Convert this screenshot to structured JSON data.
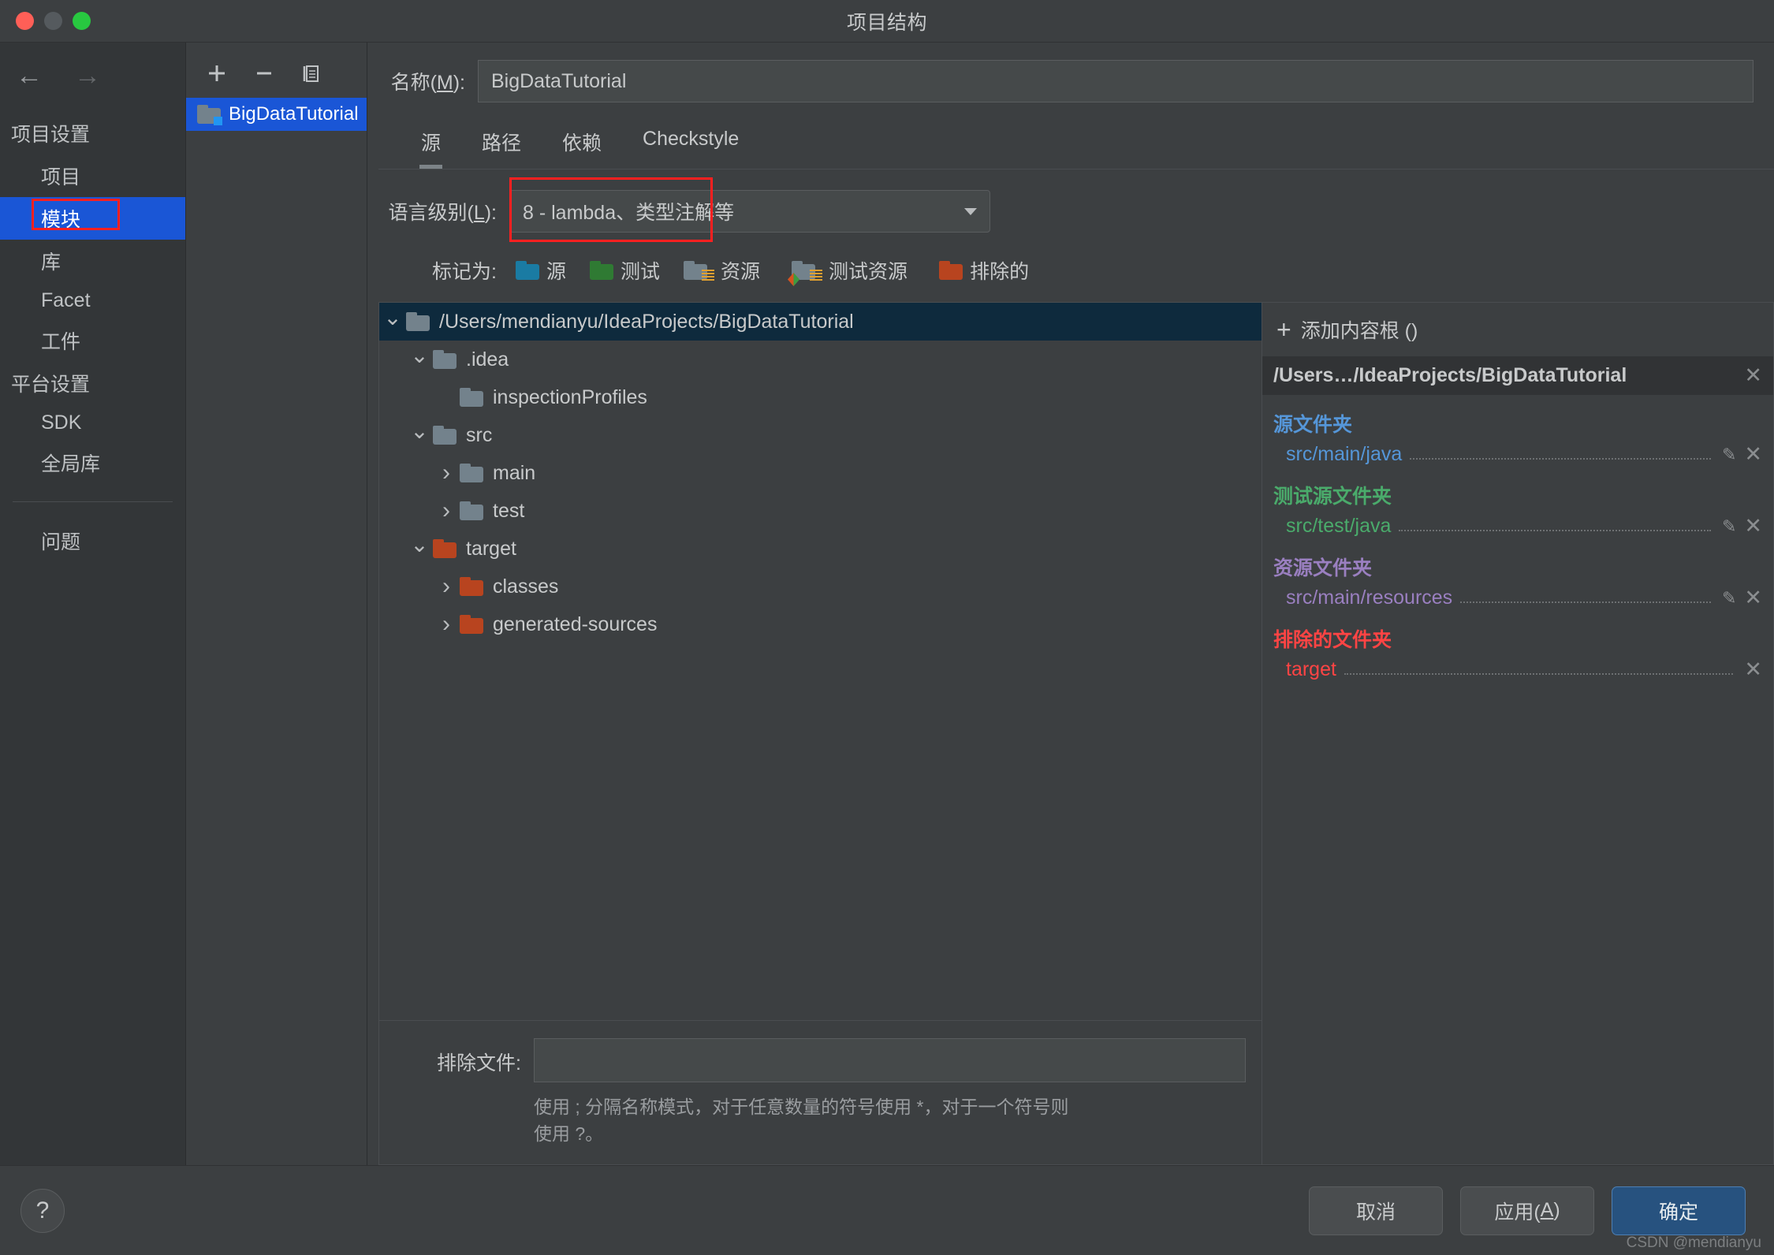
{
  "window": {
    "title": "项目结构"
  },
  "sidebar": {
    "back_icon": "arrow-left-icon",
    "forward_icon": "arrow-right-icon",
    "groups": [
      {
        "label": "项目设置",
        "items": [
          {
            "label": "项目",
            "selected": false
          },
          {
            "label": "模块",
            "selected": true
          },
          {
            "label": "库",
            "selected": false
          },
          {
            "label": "Facet",
            "selected": false
          },
          {
            "label": "工件",
            "selected": false
          }
        ]
      },
      {
        "label": "平台设置",
        "items": [
          {
            "label": "SDK",
            "selected": false
          },
          {
            "label": "全局库",
            "selected": false
          }
        ]
      }
    ],
    "problems": "问题"
  },
  "modules": {
    "toolbar": {
      "add": "+",
      "remove": "−",
      "copy": "copy-icon"
    },
    "items": [
      {
        "label": "BigDataTutorial",
        "selected": true
      }
    ]
  },
  "detail": {
    "name_label": "名称(M):",
    "name_label_pre": "名称(",
    "name_label_key": "M",
    "name_label_post": "):",
    "name_value": "BigDataTutorial",
    "tabs": [
      {
        "label": "源",
        "active": true
      },
      {
        "label": "路径",
        "active": false
      },
      {
        "label": "依赖",
        "active": false
      },
      {
        "label": "Checkstyle",
        "active": false
      }
    ],
    "language_level": {
      "label_pre": "语言级别(",
      "label_key": "L",
      "label_post": "):",
      "value": "8 - lambda、类型注解等"
    },
    "mark_as": {
      "label": "标记为:",
      "options": [
        {
          "label": "源",
          "color": "#1a7ba3",
          "kind": "sources"
        },
        {
          "label": "测试",
          "color": "#2f7a33",
          "kind": "tests"
        },
        {
          "label": "资源",
          "color": "#73828c",
          "kind": "resources"
        },
        {
          "label": "测试资源",
          "color": "#73828c",
          "kind": "test-resources"
        },
        {
          "label": "排除的",
          "color": "#b8441f",
          "kind": "excluded"
        }
      ]
    },
    "tree": [
      {
        "label": "/Users/mendianyu/IdeaProjects/BigDataTutorial",
        "depth": 0,
        "twisty": "down",
        "color": "grey",
        "selected": true
      },
      {
        "label": ".idea",
        "depth": 1,
        "twisty": "down",
        "color": "grey",
        "selected": false
      },
      {
        "label": "inspectionProfiles",
        "depth": 2,
        "twisty": "none",
        "color": "grey",
        "selected": false
      },
      {
        "label": "src",
        "depth": 1,
        "twisty": "down",
        "color": "grey",
        "selected": false
      },
      {
        "label": "main",
        "depth": 2,
        "twisty": "right",
        "color": "grey",
        "selected": false
      },
      {
        "label": "test",
        "depth": 2,
        "twisty": "right",
        "color": "grey",
        "selected": false
      },
      {
        "label": "target",
        "depth": 1,
        "twisty": "down",
        "color": "red",
        "selected": false
      },
      {
        "label": "classes",
        "depth": 2,
        "twisty": "right",
        "color": "red",
        "selected": false
      },
      {
        "label": "generated-sources",
        "depth": 2,
        "twisty": "right",
        "color": "red",
        "selected": false
      }
    ],
    "exclude": {
      "label": "排除文件:",
      "value": "",
      "hint": "使用 ; 分隔名称模式，对于任意数量的符号使用 *，对于一个符号则使用 ?。"
    }
  },
  "roots": {
    "add_label": "添加内容根 ()",
    "add_icon": "plus-icon",
    "root_path": "/Users…/IdeaProjects/BigDataTutorial",
    "root_close_icon": "close-icon",
    "sections": [
      {
        "title": "源文件夹",
        "path": "src/main/java",
        "color": "#5596d8",
        "edit_icon": "pencil-icon",
        "close_icon": "close-icon",
        "has_edit": true
      },
      {
        "title": "测试源文件夹",
        "path": "src/test/java",
        "color": "#4aab6b",
        "edit_icon": "pencil-icon",
        "close_icon": "close-icon",
        "has_edit": true
      },
      {
        "title": "资源文件夹",
        "path": "src/main/resources",
        "color": "#9a7fc0",
        "edit_icon": "pencil-icon",
        "close_icon": "close-icon",
        "has_edit": true
      },
      {
        "title": "排除的文件夹",
        "path": "target",
        "color": "#ff4444",
        "edit_icon": "",
        "close_icon": "close-icon",
        "has_edit": false
      }
    ]
  },
  "footer": {
    "help_icon": "question-mark-icon",
    "cancel": "取消",
    "apply_pre": "应用(",
    "apply_key": "A",
    "apply_post": ")",
    "ok": "确定",
    "watermark": "CSDN @mendianyu"
  },
  "colors": {
    "accent": "#1a56d6",
    "highlight": "#ff2020",
    "primary_button": "#27527f"
  }
}
